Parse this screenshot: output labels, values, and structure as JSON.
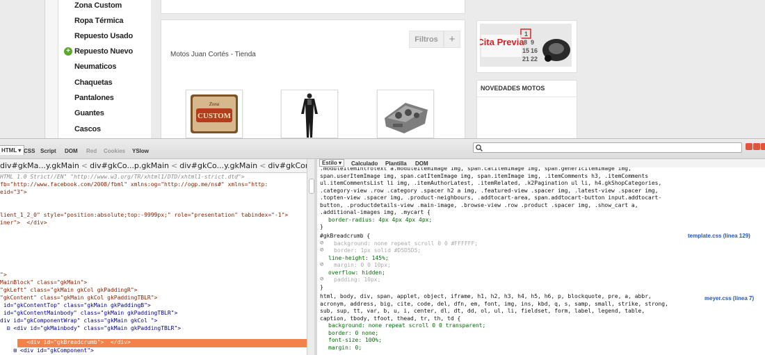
{
  "sidebar": {
    "items": [
      {
        "label": "Zona Custom"
      },
      {
        "label": "Ropa Térmica"
      },
      {
        "label": "Repuesto Usado"
      },
      {
        "label": "Repuesto Nuevo",
        "icon": "plus-icon"
      },
      {
        "label": "Neumaticos"
      },
      {
        "label": "Chaquetas"
      },
      {
        "label": "Pantalones"
      },
      {
        "label": "Guantes"
      },
      {
        "label": "Cascos"
      }
    ]
  },
  "shop": {
    "title": "Motos Juan Cortés - Tienda",
    "filter_label": "Filtros",
    "add_label": "+",
    "thumb_label": "Zona"
  },
  "banner": {
    "text": "Cita Previa",
    "calendar_numbers": [
      "1",
      "8",
      "9",
      "15",
      "16",
      "21",
      "22"
    ]
  },
  "news": {
    "title": "NOVEDADES MOTOS"
  },
  "devtools": {
    "panel_tabs": [
      "HTML ▾",
      "CSS",
      "Script",
      "DOM",
      "Red",
      "Cookies",
      "YSlow"
    ],
    "side_tabs": [
      "Estilo ▾",
      "Calculado",
      "Plantilla",
      "DOM"
    ],
    "breadcrumb": [
      "div#gkMa...y.gkMain",
      "div#gkCo...p.gkMain",
      "div#gkCo...y.gkMain",
      "div#gkContent.gk"
    ],
    "html_lines": [
      "HTML 1.0 Strict//EN\" \"http://www.w3.org/TR/xhtml1/DTD/xhtml1-strict.dtd\">",
      "fb=\"http://www.facebook.com/2008/fbml\" xmlns:og=\"http://ogp.me/ns#\" xmlns=\"http:",
      "eid=\"3\">",
      "",
      "",
      "lient_1_2_0\" style=\"position:absolute;top:-9999px;\" role=\"presentation\" tabindex=\"-1\">",
      "iner\">  </div>",
      "",
      "",
      "",
      "",
      "",
      "\">",
      "MainBlock\" class=\"gkMain\">",
      "\"gkLeft\" class=\"gkMain gkCol gkPaddingR\">",
      "\"gkContent\" class=\"gkMain gkCol gkPaddingTBLR\">",
      " id=\"gkContentTop\" class=\"gkMain gkPaddingB\">",
      " id=\"gkContentMainbody\" class=\"gkMain gkPaddingTBLR\">",
      "div id=\"gkComponentWrap\" class=\"gkMain gkCol \">",
      "  ⊟ <div id=\"gkMainbody\" class=\"gkMain gkPaddingTBLR\">",
      "        <div id=\"gkBreadcrumb\">  </div>",
      "    ⊞ <div id=\"gkComponent\">"
    ],
    "css_lines": [
      {
        "kind": "sel",
        "text": ".moduleItemIntrotext a.moduleItemImage img, span.catItemImage img, span.genericItemImage img,"
      },
      {
        "kind": "sel",
        "text": "span.userItemImage img, span.catItemImage img, span.itemImage img, .itemComments h3, .itemComments"
      },
      {
        "kind": "sel",
        "text": "ul.itemCommentsList li img, .itemAuthorLatest, .itemRelated, .k2Pagination ul li, h4.gkShopCategories,"
      },
      {
        "kind": "sel",
        "text": ".category-view .row .category .spacer h2 a img, .featured-view .spacer img, .latest-view .spacer img,"
      },
      {
        "kind": "sel",
        "text": ".topten-view .spacer img, .product-neighbours, .addtocart-area, span.addtocart-button input.addtocart-"
      },
      {
        "kind": "sel",
        "text": "button, .productdetails-view .main-image, .browse-view .row .product .spacer img, .show_cart a,"
      },
      {
        "kind": "sel",
        "text": ".additional-images img, .mycart {"
      },
      {
        "kind": "prop",
        "text": "border-radius: 4px 4px 4px 4px;"
      },
      {
        "kind": "sel",
        "text": "}"
      },
      {
        "kind": "sel",
        "text": "#gkBreadcrumb {"
      },
      {
        "kind": "over",
        "text": "background: none repeat scroll 0 0 #FFFFFF;"
      },
      {
        "kind": "over",
        "text": "border: 1px solid #D5D5D5;"
      },
      {
        "kind": "prop",
        "text": "line-height: 145%;"
      },
      {
        "kind": "over",
        "text": "margin: 0 0 10px;"
      },
      {
        "kind": "prop",
        "text": "overflow: hidden;"
      },
      {
        "kind": "over",
        "text": "padding: 10px;"
      },
      {
        "kind": "sel",
        "text": "}"
      },
      {
        "kind": "sel",
        "text": "html, body, div, span, applet, object, iframe, h1, h2, h3, h4, h5, h6, p, blockquote, pre, a, abbr,"
      },
      {
        "kind": "sel",
        "text": "acronym, address, big, cite, code, del, dfn, em, font, img, ins, kbd, q, s, samp, small, strike, strong,"
      },
      {
        "kind": "sel",
        "text": "sub, sup, tt, var, b, u, i, center, dl, dt, dd, ol, ul, li, fieldset, form, label, legend, table,"
      },
      {
        "kind": "sel",
        "text": "caption, tbody, tfoot, thead, tr, th, td {"
      },
      {
        "kind": "prop",
        "text": "background: none repeat scroll 0 0 transparent;"
      },
      {
        "kind": "prop",
        "text": "border: 0 none;"
      },
      {
        "kind": "prop",
        "text": "font-size: 100%;"
      },
      {
        "kind": "prop",
        "text": "margin: 0;"
      }
    ],
    "css_links": [
      "template.css (línea 129)",
      "meyer.css (línea 7)"
    ]
  },
  "colors": {
    "selection": "#f2824a",
    "link": "#2255bb",
    "plus_icon": "#5aaa2a"
  }
}
